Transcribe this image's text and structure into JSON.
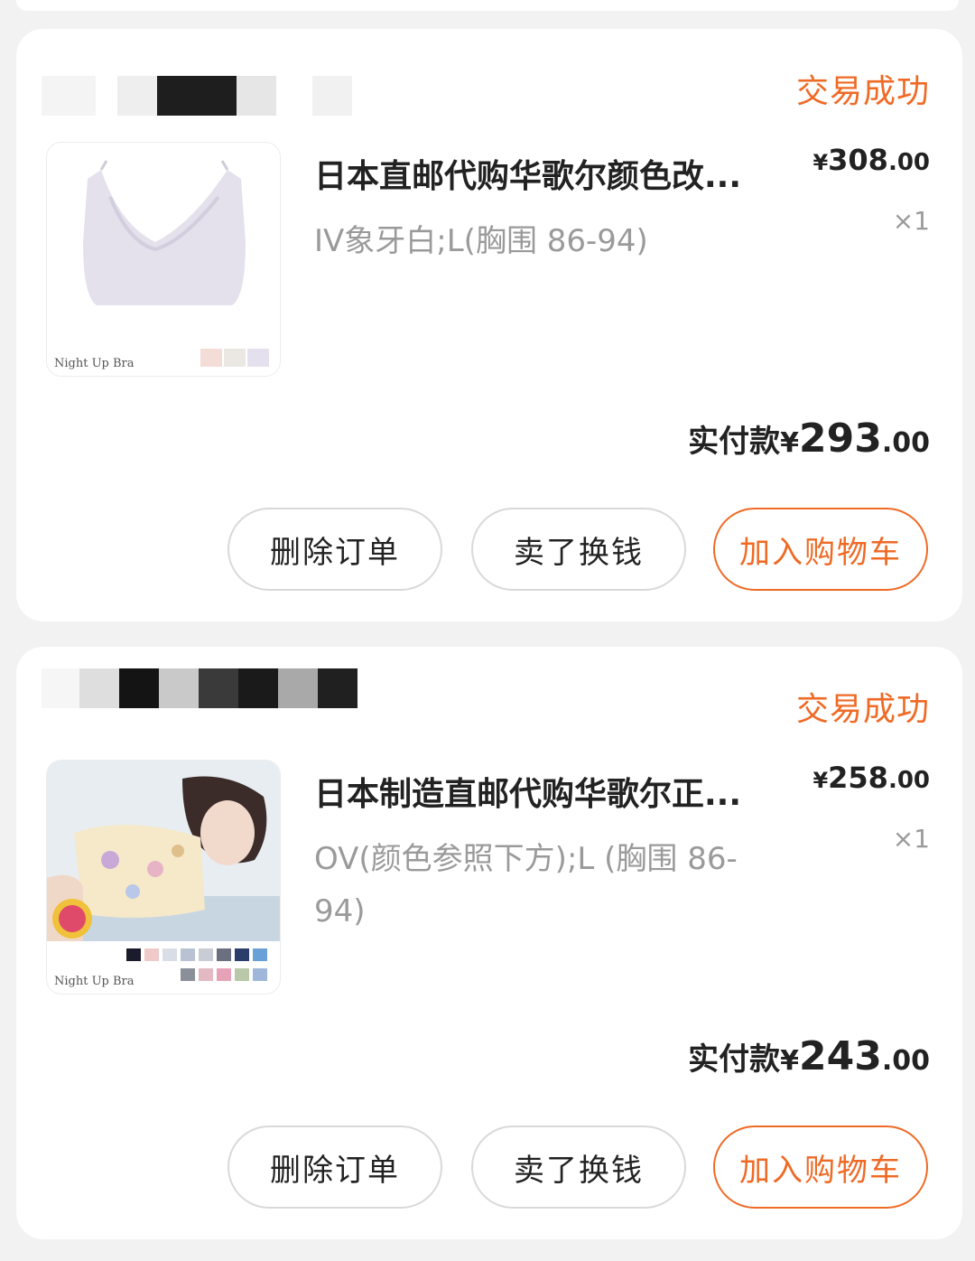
{
  "orders": [
    {
      "status": "交易成功",
      "title": "日本直邮代购华歌尔颜色改...",
      "spec": "IV象牙白;L(胸围 86-94)",
      "price_int": "308",
      "price_dec": ".00",
      "currency": "¥",
      "quantity": "×1",
      "paid_label": "实付款",
      "paid_int": "293",
      "paid_dec": ".00",
      "image_caption": "Night Up Bra",
      "buttons": {
        "delete": "删除订单",
        "sell": "卖了换钱",
        "add_to_cart": "加入购物车"
      }
    },
    {
      "status": "交易成功",
      "title": "日本制造直邮代购华歌尔正...",
      "spec": "OV(颜色参照下方);L (胸围 86-94)",
      "price_int": "258",
      "price_dec": ".00",
      "currency": "¥",
      "quantity": "×1",
      "paid_label": "实付款",
      "paid_int": "243",
      "paid_dec": ".00",
      "image_caption": "Night Up Bra",
      "buttons": {
        "delete": "删除订单",
        "sell": "卖了换钱",
        "add_to_cart": "加入购物车"
      }
    }
  ],
  "colors": {
    "accent": "#ef6a25",
    "text": "#222222",
    "muted": "#9a9a9a"
  }
}
